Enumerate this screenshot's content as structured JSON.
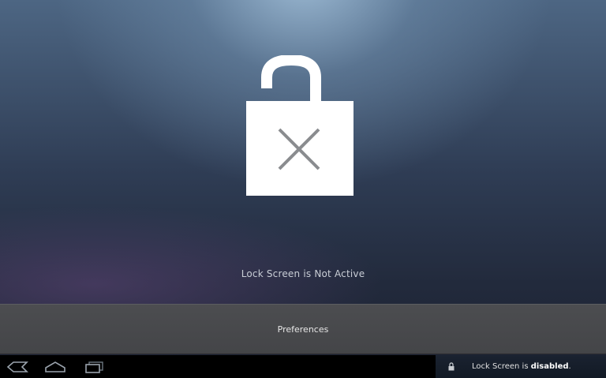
{
  "main": {
    "status_text": "Lock Screen is Not Active",
    "icon": "unlocked-padlock-with-x-icon"
  },
  "preferences": {
    "label": "Preferences"
  },
  "system_bar": {
    "nav_icons": [
      "back-icon",
      "home-icon",
      "recent-apps-icon"
    ],
    "notification": {
      "icon": "lock-icon",
      "text_prefix": "Lock Screen is ",
      "text_bold": "disabled",
      "text_suffix": "."
    }
  },
  "colors": {
    "lock_fill": "#ffffff",
    "x_mark": "#8a8c8f",
    "preferences_bar": "#48494c",
    "status_text": "#c9ced6"
  }
}
